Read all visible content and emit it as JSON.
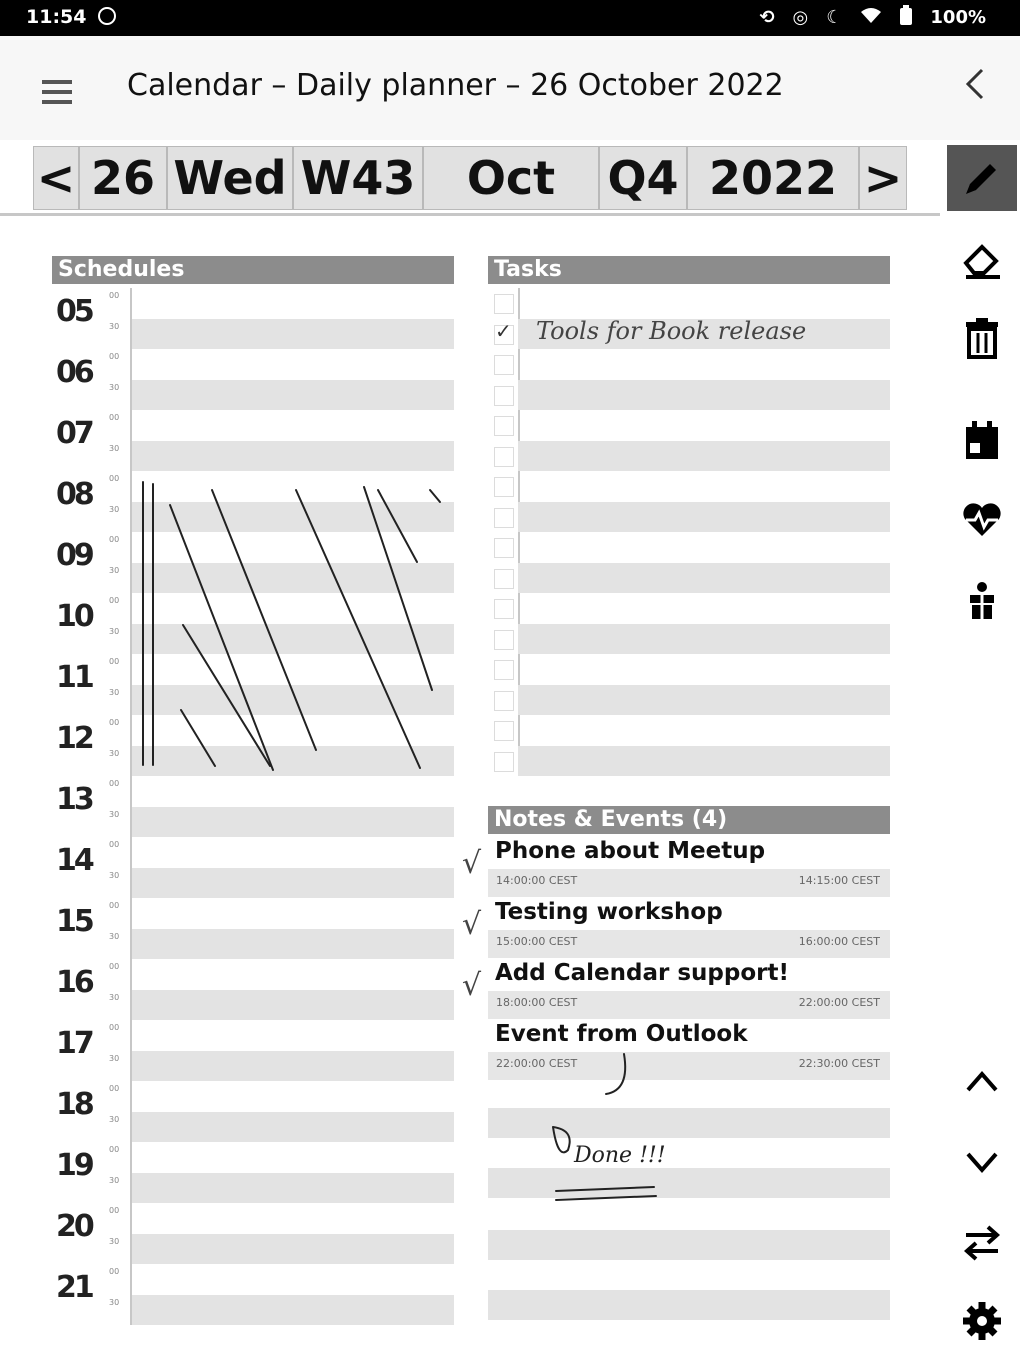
{
  "status_bar": {
    "time": "11:54",
    "battery": "100%",
    "icons": [
      "sync-icon",
      "location-icon",
      "moon-icon",
      "wifi-icon",
      "battery-icon"
    ]
  },
  "app_bar": {
    "title": "Calendar – Daily planner – 26 October 2022"
  },
  "date_nav": {
    "prev": "<",
    "day": "26",
    "weekday": "Wed",
    "week": "W43",
    "month": "Oct",
    "quarter": "Q4",
    "year": "2022",
    "next": ">"
  },
  "schedules": {
    "header": "Schedules",
    "hours": [
      "05",
      "06",
      "07",
      "08",
      "09",
      "10",
      "11",
      "12",
      "13",
      "14",
      "15",
      "16",
      "17",
      "18",
      "19",
      "20",
      "21"
    ],
    "tick_top": "00",
    "tick_bottom": "30"
  },
  "tasks": {
    "header": "Tasks",
    "items": [
      {
        "text": "",
        "checked": false
      },
      {
        "text": "Tools for Book release",
        "checked": true
      },
      {
        "text": "",
        "checked": false
      },
      {
        "text": "",
        "checked": false
      },
      {
        "text": "",
        "checked": false
      },
      {
        "text": "",
        "checked": false
      },
      {
        "text": "",
        "checked": false
      },
      {
        "text": "",
        "checked": false
      },
      {
        "text": "",
        "checked": false
      },
      {
        "text": "",
        "checked": false
      },
      {
        "text": "",
        "checked": false
      },
      {
        "text": "",
        "checked": false
      },
      {
        "text": "",
        "checked": false
      },
      {
        "text": "",
        "checked": false
      },
      {
        "text": "",
        "checked": false
      },
      {
        "text": "",
        "checked": false
      }
    ]
  },
  "notes": {
    "header": "Notes & Events (4)",
    "events": [
      {
        "title": "Phone about Meetup",
        "start": "14:00:00 CEST",
        "end": "14:15:00 CEST",
        "checked": true
      },
      {
        "title": "Testing workshop",
        "start": "15:00:00 CEST",
        "end": "16:00:00 CEST",
        "checked": true
      },
      {
        "title": "Add Calendar support!",
        "start": "18:00:00 CEST",
        "end": "22:00:00 CEST",
        "checked": true
      },
      {
        "title": "Event from Outlook",
        "start": "22:00:00 CEST",
        "end": "22:30:00 CEST",
        "checked": false
      }
    ],
    "handwriting": "Done !!!"
  },
  "toolbar": {
    "icons": [
      "pen-icon",
      "eraser-icon",
      "trash-icon",
      "calendar-today-icon",
      "heart-pulse-icon",
      "gift-icon",
      "chevron-up-icon",
      "chevron-down-icon",
      "swap-icon",
      "settings-icon"
    ]
  },
  "colors": {
    "header_gray": "#8c8c8c",
    "row_shade": "#e3e3e3",
    "status_bar": "#000000",
    "active_tool": "#555555"
  }
}
